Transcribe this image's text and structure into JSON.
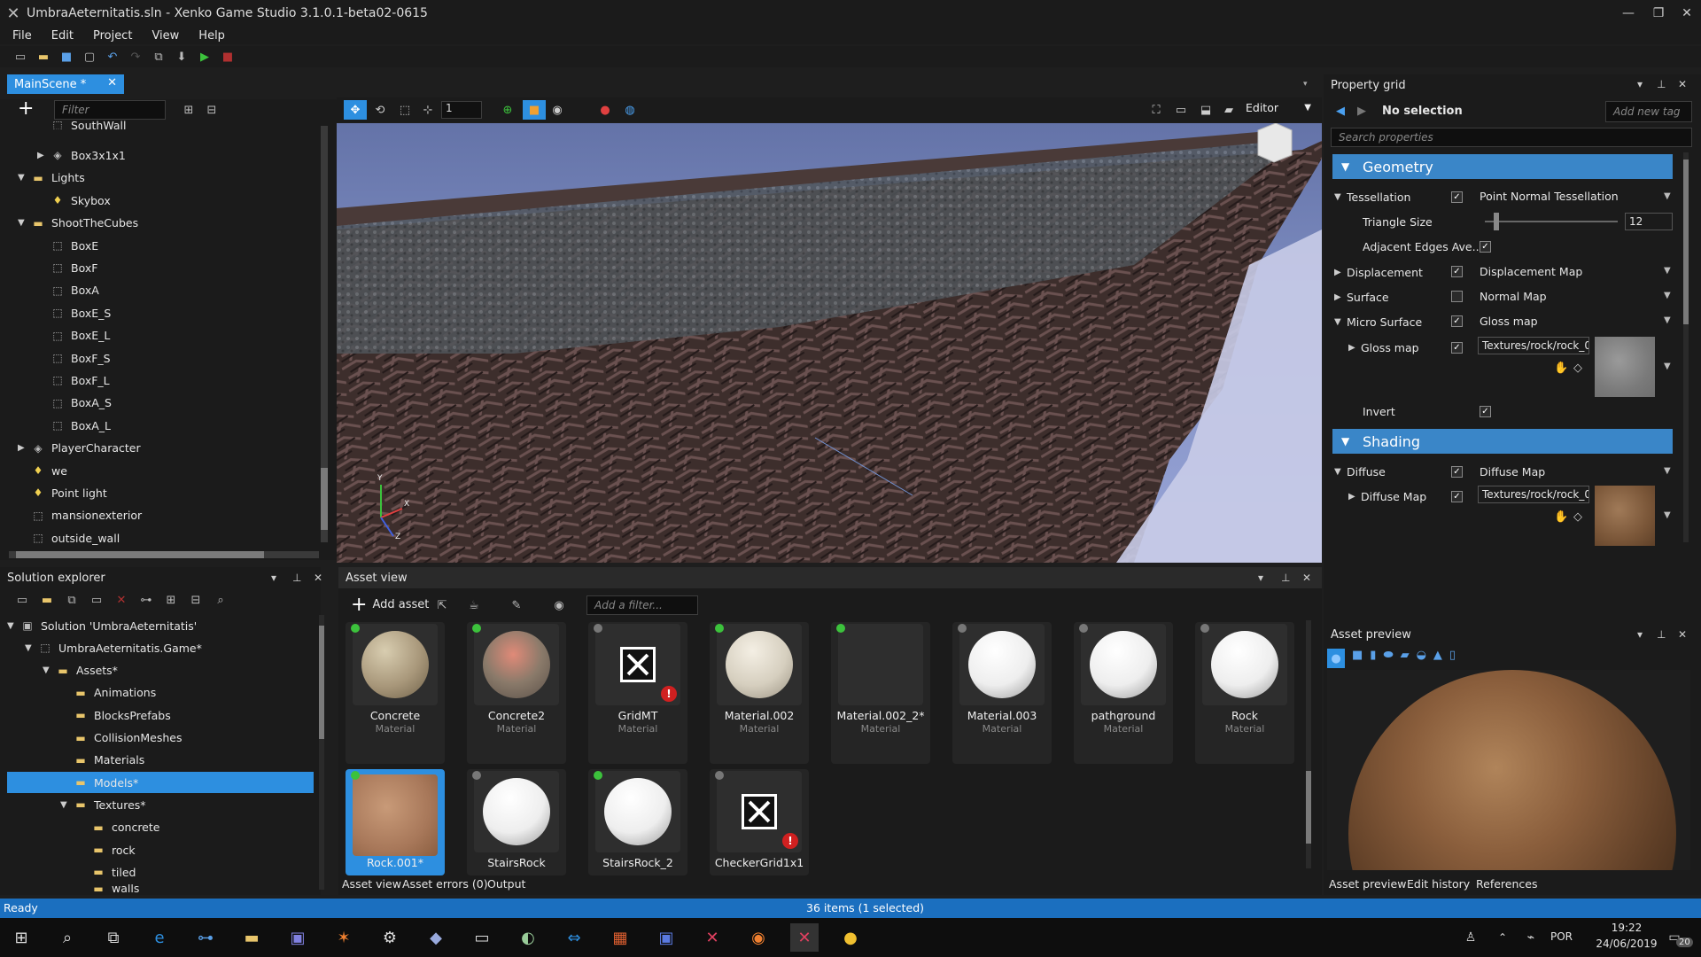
{
  "window": {
    "title": "UmbraAeternitatis.sln - Xenko Game Studio 3.1.0.1-beta02-0615"
  },
  "menu": [
    "File",
    "Edit",
    "Project",
    "View",
    "Help"
  ],
  "scene_tab": {
    "label": "MainScene *"
  },
  "scene_tree": {
    "filter_placeholder": "Filter",
    "items": [
      {
        "label": "SouthWall",
        "indent": 1,
        "icon": "entity-icon",
        "arrow": ""
      },
      {
        "label": "Box3x1x1",
        "indent": 1,
        "icon": "model-icon",
        "arrow": "▶"
      },
      {
        "label": "Lights",
        "indent": 0,
        "icon": "folder-icon",
        "arrow": "▼"
      },
      {
        "label": "Skybox",
        "indent": 1,
        "icon": "light-icon",
        "arrow": ""
      },
      {
        "label": "ShootTheCubes",
        "indent": 0,
        "icon": "folder-icon",
        "arrow": "▼"
      },
      {
        "label": "BoxE",
        "indent": 1,
        "icon": "entity-icon",
        "arrow": ""
      },
      {
        "label": "BoxF",
        "indent": 1,
        "icon": "entity-icon",
        "arrow": ""
      },
      {
        "label": "BoxA",
        "indent": 1,
        "icon": "entity-icon",
        "arrow": ""
      },
      {
        "label": "BoxE_S",
        "indent": 1,
        "icon": "entity-icon",
        "arrow": ""
      },
      {
        "label": "BoxE_L",
        "indent": 1,
        "icon": "entity-icon",
        "arrow": ""
      },
      {
        "label": "BoxF_S",
        "indent": 1,
        "icon": "entity-icon",
        "arrow": ""
      },
      {
        "label": "BoxF_L",
        "indent": 1,
        "icon": "entity-icon",
        "arrow": ""
      },
      {
        "label": "BoxA_S",
        "indent": 1,
        "icon": "entity-icon",
        "arrow": ""
      },
      {
        "label": "BoxA_L",
        "indent": 1,
        "icon": "entity-icon",
        "arrow": ""
      },
      {
        "label": "PlayerCharacter",
        "indent": 0,
        "icon": "model-icon",
        "arrow": "▶"
      },
      {
        "label": "we",
        "indent": 0,
        "icon": "light-icon",
        "arrow": ""
      },
      {
        "label": "Point light",
        "indent": 0,
        "icon": "light-icon",
        "arrow": ""
      },
      {
        "label": "mansionexterior",
        "indent": 0,
        "icon": "entity-icon",
        "arrow": ""
      },
      {
        "label": "outside_wall",
        "indent": 0,
        "icon": "entity-icon",
        "arrow": ""
      }
    ]
  },
  "viewport": {
    "grid_value": "1",
    "mode": "Editor",
    "gizmo_y": "Y",
    "gizmo_x": "X",
    "gizmo_z": "Z"
  },
  "property_grid": {
    "title": "Property grid",
    "selection": "No selection",
    "add_tag_placeholder": "Add new tag",
    "search_placeholder": "Search properties",
    "geometry_label": "Geometry",
    "tessellation_label": "Tessellation",
    "tessellation_value": "Point Normal Tessellation",
    "triangle_size_label": "Triangle Size",
    "triangle_size_value": "12",
    "triangle_size_level": 0.07,
    "adjacent_label": "Adjacent Edges Ave...",
    "displacement_label": "Displacement",
    "displacement_value": "Displacement Map",
    "surface_label": "Surface",
    "surface_value": "Normal Map",
    "micro_label": "Micro Surface",
    "micro_value": "Gloss map",
    "glossmap_label": "Gloss map",
    "glossmap_path": "Textures/rock/rock_0:",
    "invert_label": "Invert",
    "shading_label": "Shading",
    "diffuse_label": "Diffuse",
    "diffuse_value": "Diffuse Map",
    "diffusemap_label": "Diffuse Map",
    "diffusemap_path": "Textures/rock/rock_0:"
  },
  "solution_explorer": {
    "title": "Solution explorer",
    "items": [
      {
        "label": "Solution 'UmbraAeternitatis'",
        "indent": 0,
        "arrow": "▼",
        "icon": "solution-icon"
      },
      {
        "label": "UmbraAeternitatis.Game*",
        "indent": 1,
        "arrow": "▼",
        "icon": "project-icon"
      },
      {
        "label": "Assets*",
        "indent": 2,
        "arrow": "▼",
        "icon": "folder-icon"
      },
      {
        "label": "Animations",
        "indent": 3,
        "arrow": "",
        "icon": "folder-icon"
      },
      {
        "label": "BlocksPrefabs",
        "indent": 3,
        "arrow": "",
        "icon": "folder-icon"
      },
      {
        "label": "CollisionMeshes",
        "indent": 3,
        "arrow": "",
        "icon": "folder-icon"
      },
      {
        "label": "Materials",
        "indent": 3,
        "arrow": "",
        "icon": "folder-icon"
      },
      {
        "label": "Models*",
        "indent": 3,
        "arrow": "",
        "icon": "folder-icon",
        "selected": true
      },
      {
        "label": "Textures*",
        "indent": 3,
        "arrow": "▼",
        "icon": "folder-icon"
      },
      {
        "label": "concrete",
        "indent": 4,
        "arrow": "",
        "icon": "folder-icon"
      },
      {
        "label": "rock",
        "indent": 4,
        "arrow": "",
        "icon": "folder-icon"
      },
      {
        "label": "tiled",
        "indent": 4,
        "arrow": "",
        "icon": "folder-icon"
      },
      {
        "label": "walls",
        "indent": 4,
        "arrow": "",
        "icon": "folder-icon"
      }
    ]
  },
  "asset_view": {
    "title": "Asset view",
    "add_asset": "Add asset",
    "filter_placeholder": "Add a filter...",
    "assets": [
      {
        "name": "Concrete",
        "kind": "Material",
        "status": "#3cc23c",
        "thumb": "concrete"
      },
      {
        "name": "Concrete2",
        "kind": "Material",
        "status": "#3cc23c",
        "thumb": "concrete2"
      },
      {
        "name": "GridMT",
        "kind": "Material",
        "status": "#777777",
        "thumb": "error"
      },
      {
        "name": "Material.002",
        "kind": "Material",
        "status": "#3cc23c",
        "thumb": "ball"
      },
      {
        "name": "Material.002_2*",
        "kind": "Material",
        "status": "#3cc23c",
        "thumb": "empty"
      },
      {
        "name": "Material.003",
        "kind": "Material",
        "status": "#777777",
        "thumb": "white"
      },
      {
        "name": "pathground",
        "kind": "Material",
        "status": "#777777",
        "thumb": "white"
      },
      {
        "name": "Rock",
        "kind": "Material",
        "status": "#777777",
        "thumb": "white"
      },
      {
        "name": "Rock.001*",
        "kind": "",
        "status": "#3cc23c",
        "thumb": "rock",
        "selected": true
      },
      {
        "name": "StairsRock",
        "kind": "",
        "status": "#777777",
        "thumb": "white"
      },
      {
        "name": "StairsRock_2",
        "kind": "",
        "status": "#3cc23c",
        "thumb": "white"
      },
      {
        "name": "CheckerGrid1x1",
        "kind": "",
        "status": "#777777",
        "thumb": "error"
      }
    ],
    "bottom_tabs": [
      "Asset view",
      "Asset errors (0)",
      "Output"
    ]
  },
  "asset_preview": {
    "title": "Asset preview",
    "bottom_tabs": [
      "Asset preview",
      "Edit history",
      "References"
    ]
  },
  "status": {
    "left": "Ready",
    "center": "36 items (1 selected)"
  },
  "taskbar": {
    "lang": "POR",
    "time": "19:22",
    "date": "24/06/2019",
    "notif": "20"
  }
}
